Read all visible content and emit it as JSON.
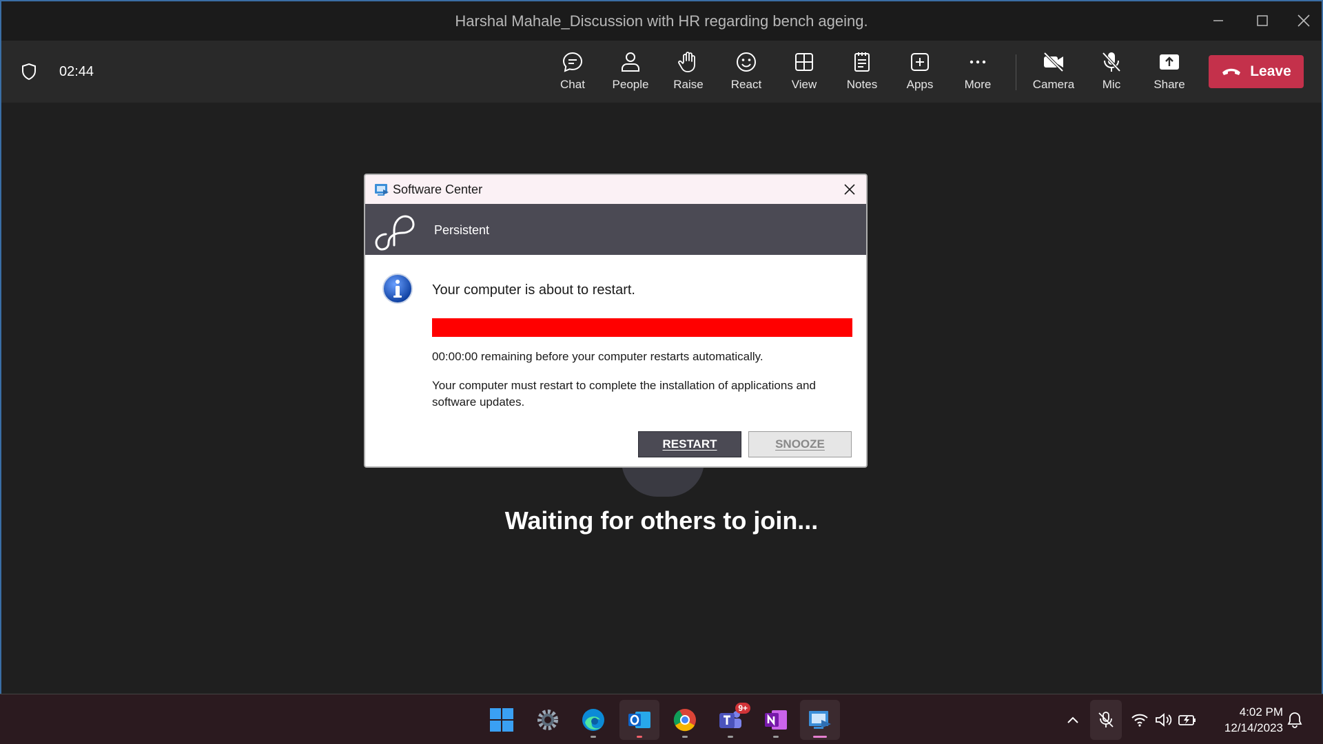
{
  "window": {
    "title": "Harshal Mahale_Discussion with HR regarding bench ageing."
  },
  "meeting": {
    "timer": "02:44",
    "toolbar": [
      {
        "id": "chat",
        "label": "Chat",
        "icon": "chat-icon"
      },
      {
        "id": "people",
        "label": "People",
        "icon": "people-icon"
      },
      {
        "id": "raise",
        "label": "Raise",
        "icon": "hand-icon"
      },
      {
        "id": "react",
        "label": "React",
        "icon": "smiley-icon"
      },
      {
        "id": "view",
        "label": "View",
        "icon": "grid-icon"
      },
      {
        "id": "notes",
        "label": "Notes",
        "icon": "notes-icon"
      },
      {
        "id": "apps",
        "label": "Apps",
        "icon": "plus-square-icon"
      },
      {
        "id": "more",
        "label": "More",
        "icon": "ellipsis-icon"
      },
      {
        "id": "camera",
        "label": "Camera",
        "icon": "camera-off-icon"
      },
      {
        "id": "mic",
        "label": "Mic",
        "icon": "mic-off-icon"
      },
      {
        "id": "share",
        "label": "Share",
        "icon": "share-icon"
      }
    ],
    "leave_label": "Leave",
    "leave_color": "#c4314b",
    "waiting_text": "Waiting for others to join..."
  },
  "dialog": {
    "title": "Software Center",
    "brand": "Persistent",
    "message": "Your computer is about to restart.",
    "progress_percent": 100,
    "progress_color": "#ff0000",
    "remaining": "00:00:00 remaining before your computer restarts automatically.",
    "detail": "Your computer must restart to complete the installation of applications and software updates.",
    "restart_label": "RESTART",
    "snooze_label": "SNOOZE"
  },
  "taskbar": {
    "teams_badge": "9+",
    "clock_time": "4:02 PM",
    "clock_date": "12/14/2023"
  }
}
